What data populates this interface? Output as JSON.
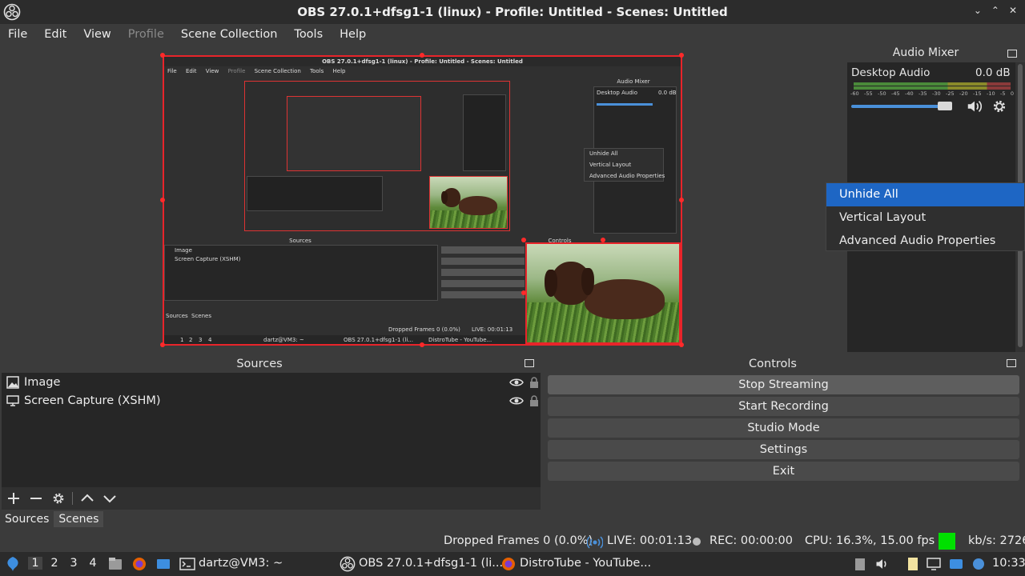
{
  "window": {
    "title": "OBS 27.0.1+dfsg1-1 (linux) - Profile: Untitled - Scenes: Untitled",
    "controls": [
      "⌄",
      "⌃",
      "✕"
    ]
  },
  "menu": [
    "File",
    "Edit",
    "View",
    "Profile",
    "Scene Collection",
    "Tools",
    "Help"
  ],
  "menu_disabled_index": 3,
  "preview": {
    "mini_menu": [
      "File",
      "Edit",
      "View",
      "Profile",
      "Scene Collection",
      "Tools",
      "Help"
    ],
    "mini_audio_mixer": "Audio Mixer",
    "mini_desktop_audio": "Desktop Audio",
    "mini_db": "0.0 dB",
    "mini_ctx": [
      "Unhide All",
      "Vertical Layout",
      "Advanced Audio Properties"
    ],
    "mini_sources_title": "Sources",
    "mini_controls_title": "Controls",
    "mini_sources": [
      "Image",
      "Screen Capture (XSHM)"
    ],
    "mini_tabs": [
      "Sources",
      "Scenes"
    ],
    "mini_status": "Dropped Frames 0 (0.0%)",
    "mini_live": "LIVE: 00:01:13",
    "mini_task_user": "dartz@VM3: ~",
    "mini_task_obs": "OBS 27.0.1+dfsg1-1 (li...",
    "mini_task_yt": "DistroTube - YouTube...",
    "mini_workspaces": [
      "1",
      "2",
      "3",
      "4"
    ]
  },
  "audio_mixer": {
    "title": "Audio Mixer",
    "channel": "Desktop Audio",
    "db": "0.0 dB",
    "ticks": [
      "-60",
      "-55",
      "-50",
      "-45",
      "-40",
      "-35",
      "-30",
      "-25",
      "-20",
      "-15",
      "-10",
      "-5",
      "0"
    ],
    "volume_fraction": 0.9
  },
  "context_menu": {
    "items": [
      "Unhide All",
      "Vertical Layout",
      "Advanced Audio Properties"
    ],
    "highlighted": 0
  },
  "sources": {
    "title": "Sources",
    "items": [
      {
        "label": "Image",
        "icon": "image-icon"
      },
      {
        "label": "Screen Capture (XSHM)",
        "icon": "monitor-icon"
      }
    ],
    "tabs": [
      "Sources",
      "Scenes"
    ]
  },
  "controls": {
    "title": "Controls",
    "buttons": [
      "Stop Streaming",
      "Start Recording",
      "Studio Mode",
      "Settings",
      "Exit"
    ]
  },
  "status": {
    "dropped": "Dropped Frames 0 (0.0%)",
    "live": "LIVE: 00:01:13",
    "rec": "REC: 00:00:00",
    "cpu": "CPU: 16.3%, 15.00 fps",
    "kbs": "kb/s: 2726",
    "indicator_color": "#00e000"
  },
  "taskbar": {
    "workspaces": [
      "1",
      "2",
      "3",
      "4"
    ],
    "active_workspace": 0,
    "terminal": "dartz@VM3: ~",
    "obs": "OBS 27.0.1+dfsg1-1 (li...",
    "browser": "DistroTube - YouTube...",
    "clock": "10:33"
  },
  "colors": {
    "accent": "#1e66c4",
    "selection_border": "#e8242a",
    "slider": "#4a90d9"
  }
}
